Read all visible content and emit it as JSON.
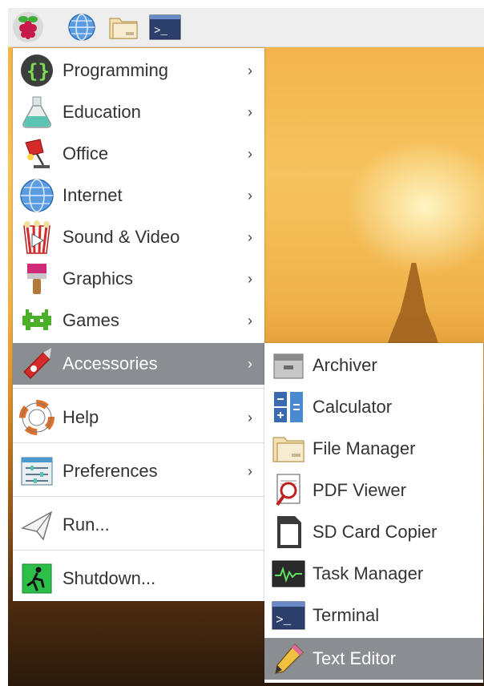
{
  "taskbar": {
    "buttons": [
      {
        "name": "raspberry-menu-icon"
      },
      {
        "name": "web-browser-icon"
      },
      {
        "name": "file-manager-icon"
      },
      {
        "name": "terminal-icon"
      }
    ]
  },
  "menu": {
    "items": [
      {
        "label": "Programming",
        "icon": "programming-icon",
        "submenu": true
      },
      {
        "label": "Education",
        "icon": "education-flask-icon",
        "submenu": true
      },
      {
        "label": "Office",
        "icon": "office-lamp-icon",
        "submenu": true
      },
      {
        "label": "Internet",
        "icon": "internet-globe-icon",
        "submenu": true
      },
      {
        "label": "Sound & Video",
        "icon": "sound-video-icon",
        "submenu": true
      },
      {
        "label": "Graphics",
        "icon": "graphics-brush-icon",
        "submenu": true
      },
      {
        "label": "Games",
        "icon": "games-invader-icon",
        "submenu": true
      },
      {
        "label": "Accessories",
        "icon": "accessories-knife-icon",
        "submenu": true,
        "active": true
      },
      {
        "label": "Help",
        "icon": "help-lifebuoy-icon",
        "submenu": true
      },
      {
        "label": "Preferences",
        "icon": "preferences-icon",
        "submenu": true
      },
      {
        "label": "Run...",
        "icon": "run-paperplane-icon",
        "submenu": false
      },
      {
        "label": "Shutdown...",
        "icon": "shutdown-exit-icon",
        "submenu": false
      }
    ],
    "arrow_glyph": "›"
  },
  "submenu": {
    "title": "Accessories",
    "items": [
      {
        "label": "Archiver",
        "icon": "archiver-icon"
      },
      {
        "label": "Calculator",
        "icon": "calculator-icon"
      },
      {
        "label": "File Manager",
        "icon": "file-manager-folder-icon"
      },
      {
        "label": "PDF Viewer",
        "icon": "pdf-viewer-icon"
      },
      {
        "label": "SD Card Copier",
        "icon": "sd-card-icon"
      },
      {
        "label": "Task Manager",
        "icon": "task-manager-icon"
      },
      {
        "label": "Terminal",
        "icon": "terminal-app-icon"
      },
      {
        "label": "Text Editor",
        "icon": "text-editor-pencil-icon",
        "active": true
      }
    ]
  },
  "colors": {
    "highlight": "#8a8d91",
    "menu_bg": "#ffffff",
    "taskbar_bg": "#eeeeee"
  }
}
